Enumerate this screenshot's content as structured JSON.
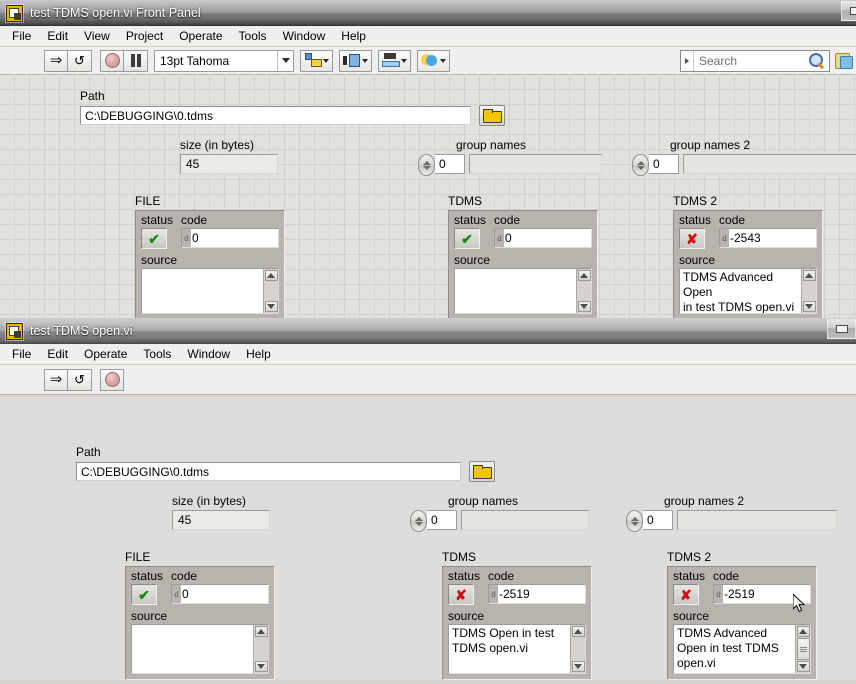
{
  "windows": [
    {
      "id": "front-panel",
      "title": "test TDMS open.vi Front Panel",
      "menus": [
        "File",
        "Edit",
        "View",
        "Project",
        "Operate",
        "Tools",
        "Window",
        "Help"
      ],
      "toolbar": {
        "run_label": "run-arrow",
        "run_continuous_label": "run-continuously",
        "abort_label": "abort-execution",
        "pause_label": "pause",
        "font_selector_value": "13pt Tahoma",
        "align_label": "align-objects",
        "distribute_label": "distribute-objects",
        "resize_label": "resize-objects",
        "reorder_label": "reorder-objects",
        "search_placeholder": "Search",
        "help_label": "context-help"
      },
      "controls": {
        "path": {
          "label": "Path",
          "value": "C:\\DEBUGGING\\0.tdms"
        },
        "size": {
          "label": "size (in bytes)",
          "value": "45"
        },
        "group_names": {
          "label": "group names",
          "index": "0",
          "value": ""
        },
        "group_names_2": {
          "label": "group names 2",
          "index": "0",
          "value": ""
        }
      },
      "clusters": [
        {
          "title": "FILE",
          "status_label": "status",
          "status_state": "ok",
          "status_glyph": "✔",
          "code_label": "code",
          "code_radix": "d",
          "code_value": "0",
          "source_label": "source",
          "source_value": ""
        },
        {
          "title": "TDMS",
          "status_label": "status",
          "status_state": "ok",
          "status_glyph": "✔",
          "code_label": "code",
          "code_radix": "d",
          "code_value": "0",
          "source_label": "source",
          "source_value": ""
        },
        {
          "title": "TDMS 2",
          "status_label": "status",
          "status_state": "error",
          "status_glyph": "✘",
          "code_label": "code",
          "code_radix": "d",
          "code_value": "-2543",
          "source_label": "source",
          "source_value": "TDMS Advanced Open\nin test TDMS open.vi"
        }
      ]
    },
    {
      "id": "front-panel-2",
      "title": "test TDMS open.vi",
      "menus": [
        "File",
        "Edit",
        "Operate",
        "Tools",
        "Window",
        "Help"
      ],
      "toolbar": {
        "run_label": "run-arrow",
        "run_continuous_label": "run-continuously",
        "abort_label": "abort-execution"
      },
      "controls": {
        "path": {
          "label": "Path",
          "value": "C:\\DEBUGGING\\0.tdms"
        },
        "size": {
          "label": "size (in bytes)",
          "value": "45"
        },
        "group_names": {
          "label": "group names",
          "index": "0",
          "value": ""
        },
        "group_names_2": {
          "label": "group names 2",
          "index": "0",
          "value": ""
        }
      },
      "clusters": [
        {
          "title": "FILE",
          "status_label": "status",
          "status_state": "ok",
          "status_glyph": "✔",
          "code_label": "code",
          "code_radix": "d",
          "code_value": "0",
          "source_label": "source",
          "source_value": ""
        },
        {
          "title": "TDMS",
          "status_label": "status",
          "status_state": "error",
          "status_glyph": "✘",
          "code_label": "code",
          "code_radix": "d",
          "code_value": "-2519",
          "source_label": "source",
          "source_value": "TDMS Open in test\nTDMS open.vi"
        },
        {
          "title": "TDMS 2",
          "status_label": "status",
          "status_state": "error",
          "status_glyph": "✘",
          "code_label": "code",
          "code_radix": "d",
          "code_value": "-2519",
          "source_label": "source",
          "source_value": "TDMS Advanced\nOpen in test TDMS\nopen.vi"
        }
      ]
    }
  ],
  "colors": {
    "panel_grid_bg": "#e2e1dd",
    "panel_plain_bg": "#dedddb",
    "cluster_bg": "#b7b4ae",
    "status_ok": "#128c12",
    "status_error": "#cc1111",
    "folder_yellow": "#f2c500"
  }
}
